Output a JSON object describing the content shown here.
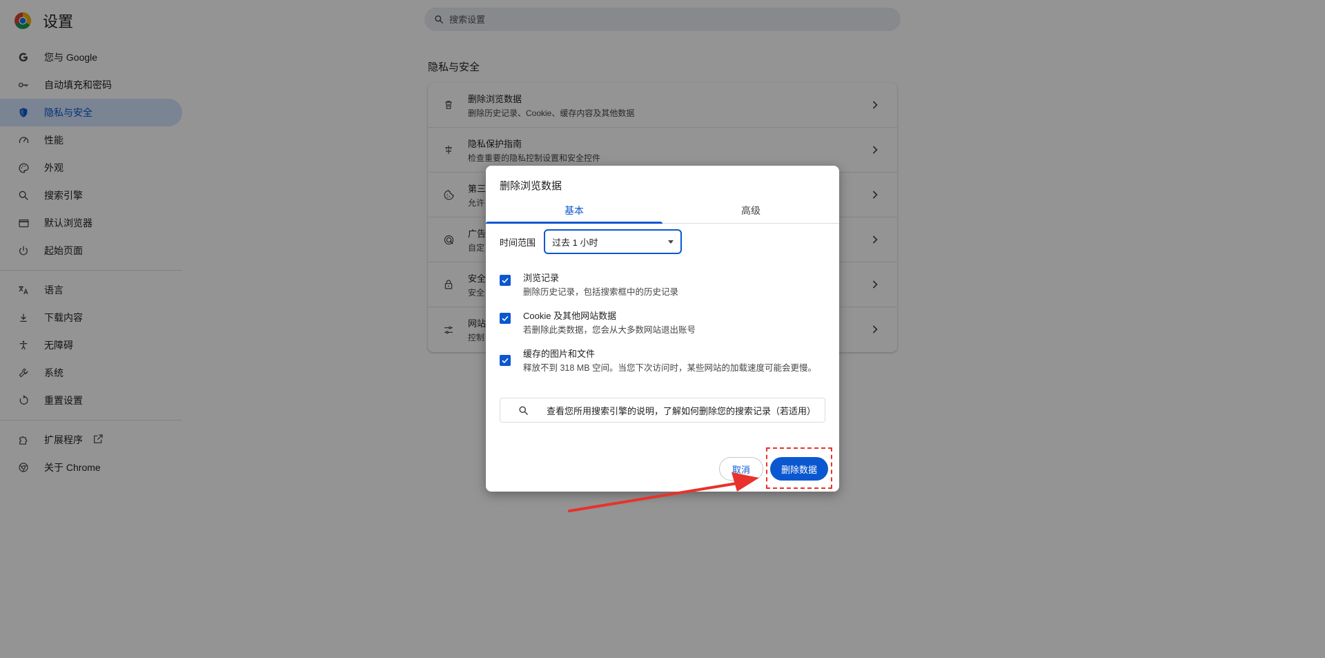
{
  "app": {
    "title": "设置",
    "logo_icon": "chrome-logo-icon"
  },
  "search": {
    "placeholder": "搜索设置"
  },
  "sidebar": {
    "items": [
      {
        "label": "您与 Google",
        "icon": "google-g-icon"
      },
      {
        "label": "自动填充和密码",
        "icon": "key-icon"
      },
      {
        "label": "隐私与安全",
        "icon": "shield-icon",
        "active": true
      },
      {
        "label": "性能",
        "icon": "speedometer-icon"
      },
      {
        "label": "外观",
        "icon": "palette-icon"
      },
      {
        "label": "搜索引擎",
        "icon": "search-icon"
      },
      {
        "label": "默认浏览器",
        "icon": "browser-window-icon"
      },
      {
        "label": "起始页面",
        "icon": "power-icon"
      }
    ],
    "items2": [
      {
        "label": "语言",
        "icon": "translate-icon"
      },
      {
        "label": "下载内容",
        "icon": "download-icon"
      },
      {
        "label": "无障碍",
        "icon": "accessibility-icon"
      },
      {
        "label": "系统",
        "icon": "wrench-icon"
      },
      {
        "label": "重置设置",
        "icon": "reset-icon"
      }
    ],
    "items3": [
      {
        "label": "扩展程序",
        "icon": "puzzle-icon",
        "external_icon": "open-in-new-icon"
      },
      {
        "label": "关于 Chrome",
        "icon": "chrome-icon"
      }
    ]
  },
  "main": {
    "section_title": "隐私与安全",
    "rows": [
      {
        "title": "删除浏览数据",
        "subtitle": "删除历史记录、Cookie、缓存内容及其他数据",
        "icon": "trash-icon"
      },
      {
        "title": "隐私保护指南",
        "subtitle": "检查重要的隐私控制设置和安全控件",
        "icon": "privacy-guide-icon"
      },
      {
        "title": "第三",
        "subtitle": "允许",
        "icon": "cookie-icon"
      },
      {
        "title": "广告",
        "subtitle": "自定",
        "icon": "ad-privacy-icon"
      },
      {
        "title": "安全",
        "subtitle": "安全",
        "icon": "lock-icon"
      },
      {
        "title": "网站",
        "subtitle": "控制",
        "icon": "tune-icon"
      }
    ]
  },
  "dialog": {
    "title": "删除浏览数据",
    "tabs": [
      {
        "label": "基本",
        "active": true
      },
      {
        "label": "高级",
        "active": false
      }
    ],
    "time_range": {
      "label": "时间范围",
      "value": "过去 1 小时"
    },
    "options": [
      {
        "title": "浏览记录",
        "subtitle": "删除历史记录，包括搜索框中的历史记录",
        "checked": true
      },
      {
        "title": "Cookie 及其他网站数据",
        "subtitle": "若删除此类数据，您会从大多数网站退出账号",
        "checked": true
      },
      {
        "title": "缓存的图片和文件",
        "subtitle": "释放不到 318 MB 空间。当您下次访问时，某些网站的加载速度可能会更慢。",
        "checked": true
      }
    ],
    "info_text": "查看您所用搜索引擎的说明，了解如何删除您的搜索记录（若适用）",
    "cancel_label": "取消",
    "delete_label": "删除数据"
  },
  "colors": {
    "accent": "#0b57d0",
    "annotation": "#e8322b",
    "active_nav_bg": "#d3e3fd"
  }
}
